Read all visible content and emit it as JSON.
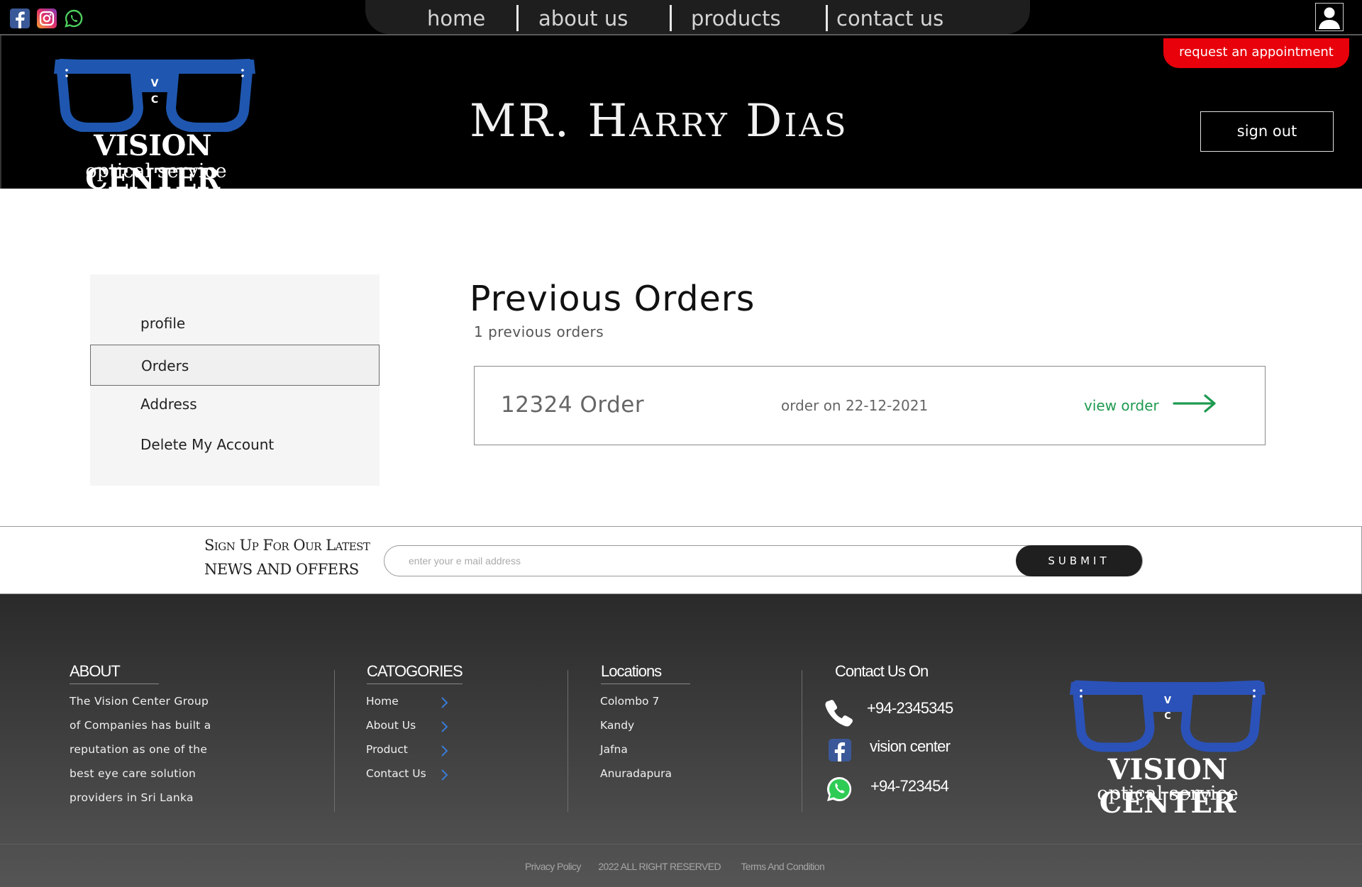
{
  "topbar": {
    "social_icons": [
      "facebook-icon",
      "instagram-icon",
      "whatsapp-icon"
    ],
    "nav": [
      "home",
      "about us",
      "products",
      "contact us"
    ],
    "user_icon": "user-icon"
  },
  "header": {
    "logo_title": "VISION CENTER",
    "logo_subtitle": "optical service",
    "logo_initials": [
      "V",
      "C"
    ],
    "customer_name": "MR. Harry Dias",
    "appointment_label": "request an appointment",
    "signout_label": "sign out"
  },
  "sidebar": {
    "items": [
      {
        "label": "profile",
        "active": false
      },
      {
        "label": "Orders",
        "active": true
      },
      {
        "label": "Address",
        "active": false
      },
      {
        "label": "Delete My Account",
        "active": false
      }
    ]
  },
  "orders": {
    "title": "Previous Orders",
    "subtitle": "1 previous orders",
    "list": [
      {
        "id": "12324 Order",
        "date": "order on 22-12-2021",
        "action": "view order"
      }
    ]
  },
  "newsletter": {
    "line1": "Sign Up For Our Latest",
    "line2": "NEWS AND OFFERS",
    "email_placeholder": "enter your e mail address",
    "submit_label": "SUBMIT"
  },
  "footer": {
    "about_heading": "ABOUT",
    "about_lines": [
      "The Vision Center Group",
      "of Companies has built a",
      "reputation as one of the",
      "best eye care solution",
      "providers in Sri Lanka"
    ],
    "categories_heading": "CATOGORIES",
    "categories": [
      "Home",
      "About Us",
      "Product",
      "Contact Us"
    ],
    "locations_heading": "Locations",
    "locations": [
      "Colombo 7",
      "Kandy",
      "Jafna",
      "Anuradapura"
    ],
    "contact_heading": "Contact Us On",
    "phone": "+94-2345345",
    "facebook": "vision center",
    "whatsapp": "+94-723454",
    "logo_title": "VISION CENTER",
    "logo_subtitle": "optical service",
    "privacy": "Privacy Policy",
    "rights": "2022 ALL RIGHT RESERVED",
    "terms": "Terms And Condition"
  },
  "colors": {
    "accent_red": "#e8000a",
    "accent_green": "#1e9a50",
    "logo_blue": "#1f57b0"
  }
}
